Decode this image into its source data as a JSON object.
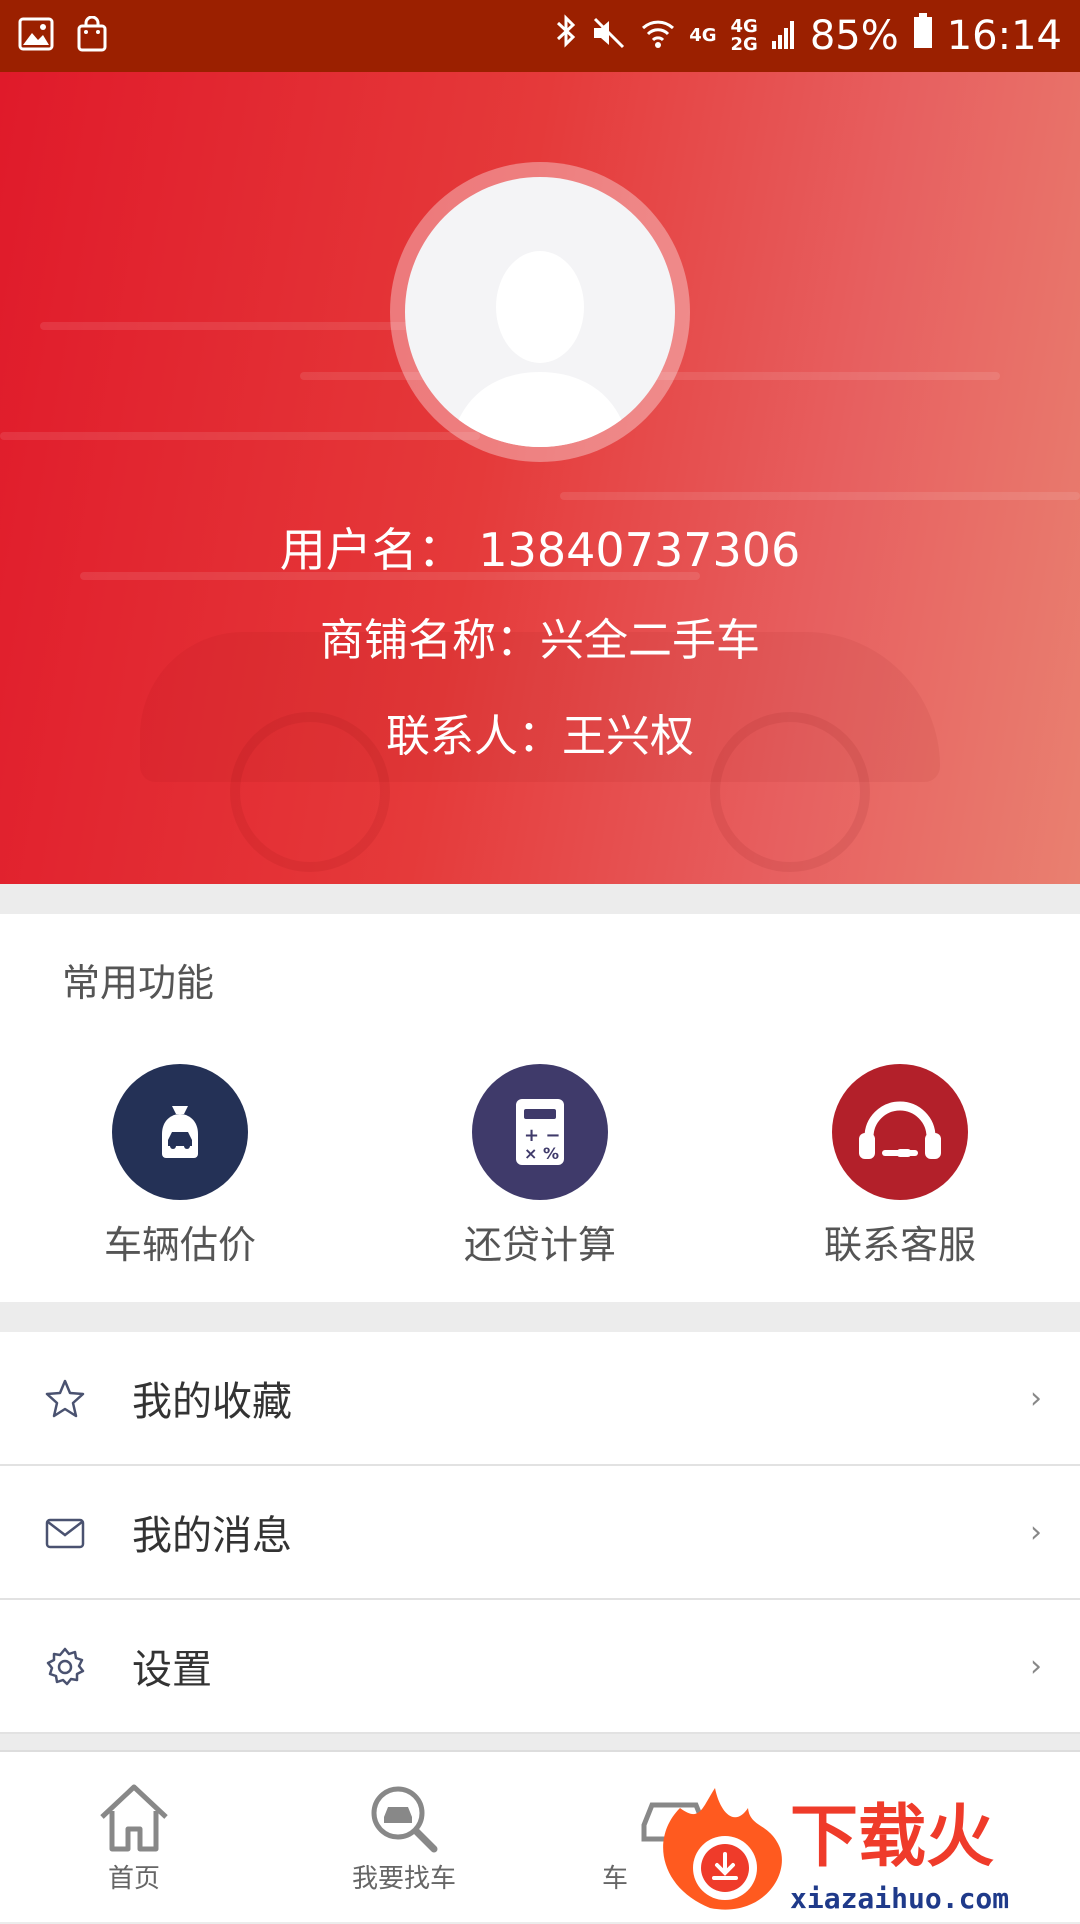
{
  "status_bar": {
    "net1": "4G",
    "net2a": "4G",
    "net2b": "2G",
    "battery": "85%",
    "time": "16:14"
  },
  "profile": {
    "username": "用户名： 13840737306",
    "shop": "商铺名称：兴全二手车",
    "contact": "联系人：王兴权"
  },
  "features": {
    "title": "常用功能",
    "items": [
      {
        "label": "车辆估价",
        "color": "#243156"
      },
      {
        "label": "还贷计算",
        "color": "#3f3a6a"
      },
      {
        "label": "联系客服",
        "color": "#b3202a"
      }
    ]
  },
  "menu": {
    "items": [
      {
        "label": "我的收藏",
        "icon": "star-icon"
      },
      {
        "label": "我的消息",
        "icon": "mail-icon"
      },
      {
        "label": "设置",
        "icon": "gear-icon"
      }
    ],
    "chevron": "›"
  },
  "tabbar": {
    "tabs": [
      {
        "label": "首页",
        "icon": "home-icon"
      },
      {
        "label": "我要找车",
        "icon": "car-search-icon"
      },
      {
        "label": "车",
        "icon": "car-icon"
      }
    ]
  },
  "watermark": {
    "title": "下载火",
    "url": "xiazaihuo.com"
  }
}
